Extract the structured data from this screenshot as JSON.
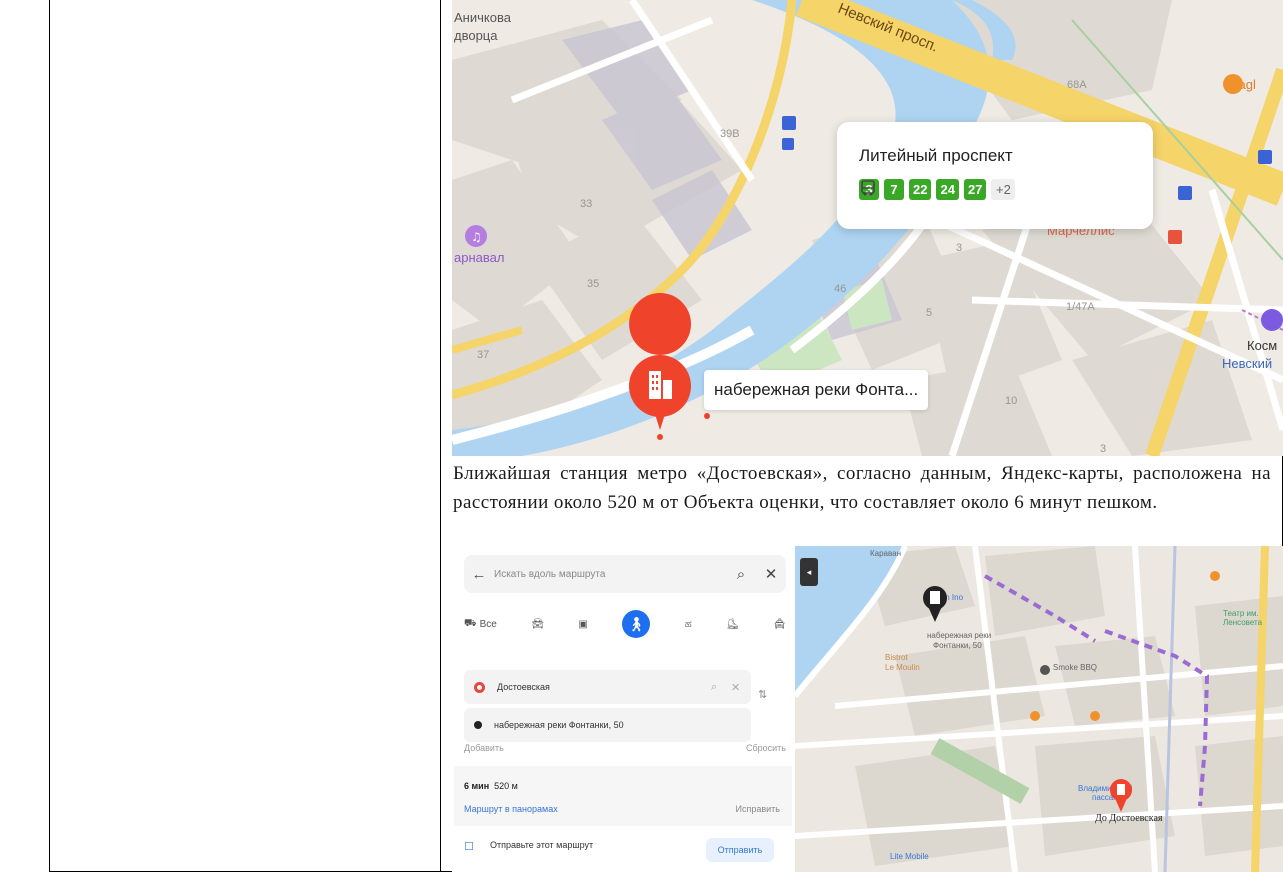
{
  "map_top": {
    "labels": {
      "anichkov": "Аничкова\nдворца",
      "nevsky": "Невский просп.",
      "karnaval": "арнавал",
      "tagl": "Tagl",
      "marcellis": "Марчеллис",
      "kosm": "Косм",
      "nevsky_short": "Невский"
    },
    "house_numbers": [
      "68А",
      "39В",
      "33",
      "35",
      "37",
      "46",
      "3",
      "5",
      "1/47А",
      "10",
      "3"
    ],
    "stop_card": {
      "title": "Литейный проспект",
      "routes": [
        "3",
        "7",
        "22",
        "24",
        "27"
      ],
      "more": "+2"
    },
    "pin_label": "набережная реки Фонта..."
  },
  "paragraph": "Ближайшая станция метро «Достоевская», согласно данным, Яндекс-карты, расположена на расстоянии около 520 м от Объекта оценки, что составляет около 6 минут пешком.",
  "route_panel": {
    "search_placeholder": "Искать вдоль маршрута",
    "mode_all": "Все",
    "from": "Достоевская",
    "to": "набережная реки Фонтанки, 50",
    "add": "Добавить",
    "reset": "Сбросить",
    "time": "6 мин",
    "distance": "520 м",
    "panorama_link": "Маршрут в панорамах",
    "fix": "Исправить",
    "send_text": "Отправьте этот маршрут",
    "send_button": "Отправить"
  },
  "map_bottom": {
    "labels": {
      "karavan": "Караван",
      "fontanka_pin": "набережная реки\nФонтанки, 50",
      "bistro": "Bistrot\nLe Moulin",
      "smoke": "Smoke BBQ",
      "teatr": "Театр им.\nЛенсовета",
      "metro": "До Достоевская",
      "vladimir": "Владимирский\nпассаж",
      "lite_mobile": "Lite Mobile",
      "dan_ino": "Dan Ino"
    }
  },
  "colors": {
    "water": "#aed4f2",
    "road_yellow": "#f5d469",
    "park": "#cde6c2",
    "building": "#dedad3",
    "accent_red": "#f0432b",
    "route_green": "#3aa827",
    "walk_route": "#9b6bd4"
  }
}
